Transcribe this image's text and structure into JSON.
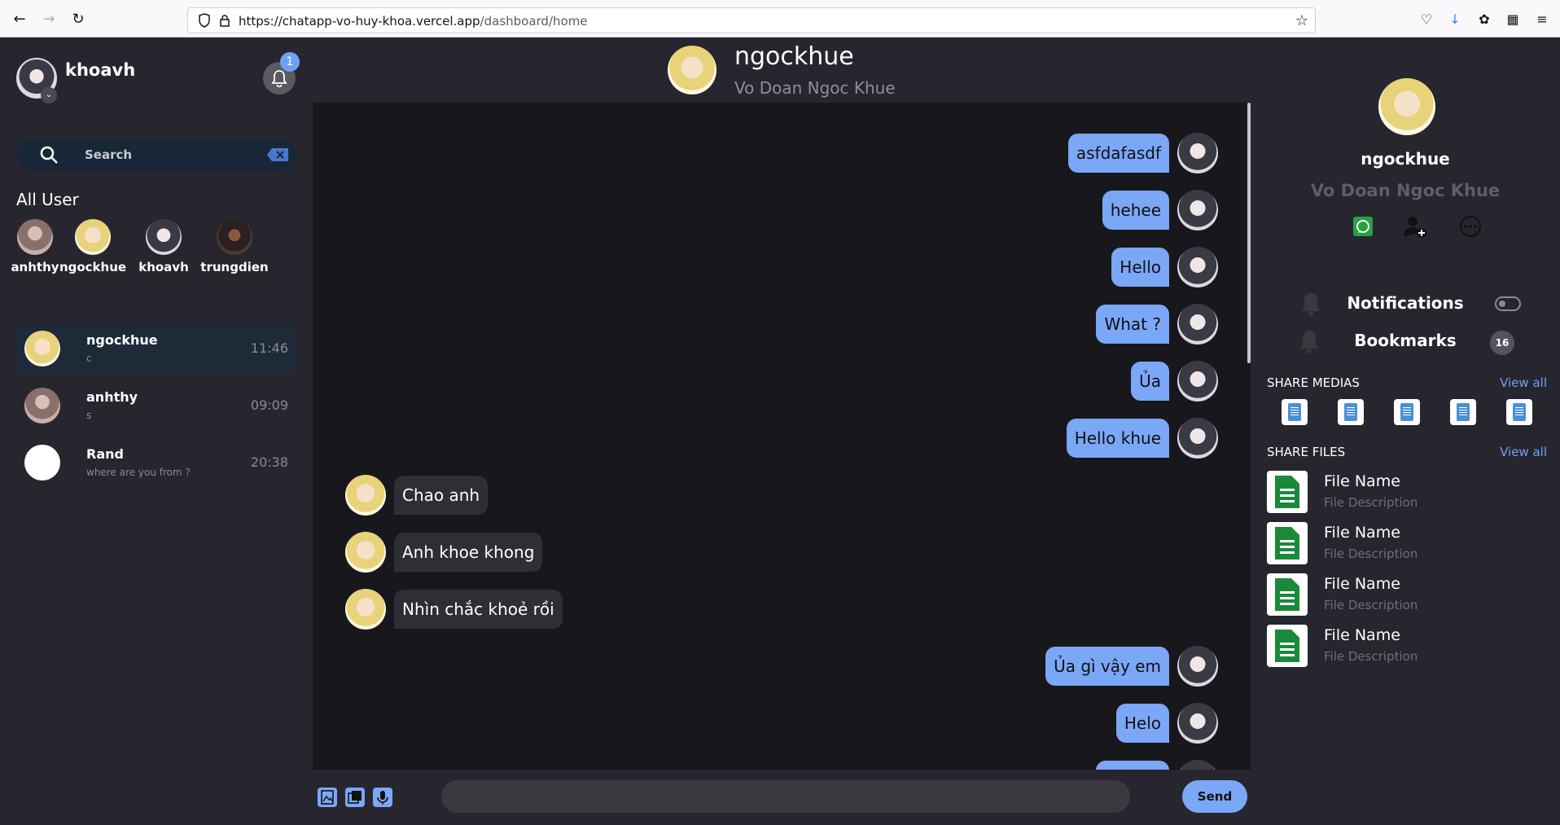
{
  "browser": {
    "url_host": "https://chatapp-vo-huy-khoa.vercel.app",
    "url_path": "/dashboard/home"
  },
  "sidebar": {
    "me": {
      "name": "khoavh"
    },
    "notifications_count": "1",
    "search": {
      "placeholder": "Search"
    },
    "all_user_title": "All User",
    "all_users": [
      {
        "name": "anhthy"
      },
      {
        "name": "ngockhue"
      },
      {
        "name": "khoavh"
      },
      {
        "name": "trungdien"
      }
    ],
    "conversations": [
      {
        "name": "ngockhue",
        "preview": "c",
        "time": "11:46"
      },
      {
        "name": "anhthy",
        "preview": "s",
        "time": "09:09"
      },
      {
        "name": "Rand",
        "preview": "where are you from ?",
        "time": "20:38"
      }
    ]
  },
  "chat": {
    "header": {
      "username": "ngockhue",
      "full_name": "Vo Doan Ngoc Khue"
    },
    "messages": [
      {
        "dir": "out",
        "text": "asfdafasdf"
      },
      {
        "dir": "out",
        "text": "hehee"
      },
      {
        "dir": "out",
        "text": "Hello"
      },
      {
        "dir": "out",
        "text": "What ?"
      },
      {
        "dir": "out",
        "text": "Ủa"
      },
      {
        "dir": "out",
        "text": "Hello khue"
      },
      {
        "dir": "in",
        "text": "Chao anh"
      },
      {
        "dir": "in",
        "text": "Anh khoe khong"
      },
      {
        "dir": "in",
        "text": "Nhìn chắc khoẻ rồi"
      },
      {
        "dir": "out",
        "text": "Ủa gì vậy em"
      },
      {
        "dir": "out",
        "text": "Helo"
      }
    ],
    "composer": {
      "value": "",
      "send_label": "Send"
    }
  },
  "profile": {
    "username": "ngockhue",
    "full_name": "Vo Doan Ngoc Khue",
    "notifications_label": "Notifications",
    "bookmarks_label": "Bookmarks",
    "bookmarks_count": "16",
    "share_medias_title": "SHARE MEDIAS",
    "share_files_title": "SHARE FILES",
    "view_all": "View all",
    "files": [
      {
        "name": "File Name",
        "desc": "File Description"
      },
      {
        "name": "File Name",
        "desc": "File Description"
      },
      {
        "name": "File Name",
        "desc": "File Description"
      },
      {
        "name": "File Name",
        "desc": "File Description"
      }
    ]
  },
  "colors": {
    "accent": "#7ba7f7",
    "panel": "#27262e",
    "chat_bg": "#18171c",
    "whatsapp": "#25a244"
  }
}
